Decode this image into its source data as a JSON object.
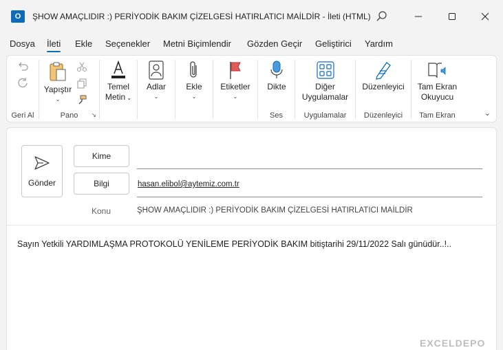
{
  "window": {
    "title": "ŞHOW AMAÇLIDIR :) PERİYODİK BAKIM ÇİZELGESİ HATIRLATICI MAİLDİR  -  İleti (HTML)",
    "app_icon_letter": "O"
  },
  "menu": {
    "tabs": [
      {
        "label": "Dosya"
      },
      {
        "label": "İleti"
      },
      {
        "label": "Ekle"
      },
      {
        "label": "Seçenekler"
      },
      {
        "label": "Metni Biçimlendir"
      },
      {
        "label": "Gözden Geçir"
      },
      {
        "label": "Geliştirici"
      },
      {
        "label": "Yardım"
      }
    ],
    "active": "İleti"
  },
  "ribbon": {
    "groups": {
      "undo": {
        "label": "Geri Al"
      },
      "clipboard": {
        "label": "Pano",
        "paste_label": "Yapıştır"
      },
      "basic_text": {
        "label_line1": "Temel",
        "label_line2": "Metin"
      },
      "names": {
        "label": "Adlar"
      },
      "include": {
        "label": "Ekle"
      },
      "tags": {
        "label": "Etiketler"
      },
      "voice": {
        "label": "Ses",
        "dictate_label": "Dikte"
      },
      "apps": {
        "label": "Uygulamalar",
        "more_apps_line1": "Diğer",
        "more_apps_line2": "Uygulamalar"
      },
      "editor": {
        "label": "Düzenleyici",
        "editor_btn": "Düzenleyici"
      },
      "immersive": {
        "label": "Tam Ekran",
        "reader_line1": "Tam Ekran",
        "reader_line2": "Okuyucu"
      }
    }
  },
  "compose": {
    "send_label": "Gönder",
    "to_label": "Kime",
    "cc_label": "Bilgi",
    "to_value": "",
    "cc_value": "hasan.elibol@aytemiz.com.tr",
    "subject_label": "Konu",
    "subject_value": "ŞHOW AMAÇLIDIR :) PERİYODİK BAKIM ÇİZELGESİ HATIRLATICI MAİLDİR",
    "body": "Sayın Yetkili YARDIMLAŞMA PROTOKOLÜ YENİLEME PERİYODİK BAKIM bitiştarihi 29/11/2022  Salı günüdür..!.."
  },
  "watermark": "EXCELDEPO",
  "colors": {
    "accent": "#0f6cbd",
    "background": "#f3f3f3",
    "panel": "#ffffff"
  }
}
